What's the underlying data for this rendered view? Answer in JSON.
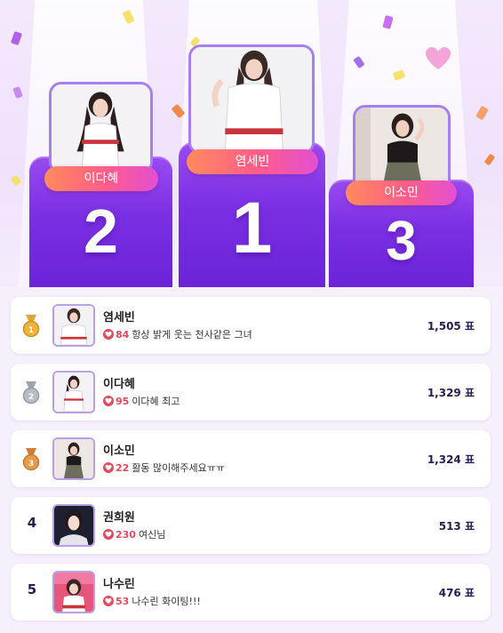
{
  "podium": [
    {
      "rank_label": "2",
      "name": "이다혜"
    },
    {
      "rank_label": "1",
      "name": "염세빈"
    },
    {
      "rank_label": "3",
      "name": "이소민"
    }
  ],
  "leaderboard": [
    {
      "rank": 1,
      "rank_label": "",
      "medal": "gold-medal-icon",
      "name": "염세빈",
      "hearts": "84",
      "message": "항상 밝게 웃는 천사같은 그녀",
      "votes": "1,505 표"
    },
    {
      "rank": 2,
      "rank_label": "",
      "medal": "silver-medal-icon",
      "name": "이다혜",
      "hearts": "95",
      "message": "이다혜 최고",
      "votes": "1,329 표"
    },
    {
      "rank": 3,
      "rank_label": "",
      "medal": "bronze-medal-icon",
      "name": "이소민",
      "hearts": "22",
      "message": "활동 많이해주세요ㅠㅠ",
      "votes": "1,324 표"
    },
    {
      "rank": 4,
      "rank_label": "4",
      "medal": "",
      "name": "권희원",
      "hearts": "230",
      "message": "여신님",
      "votes": "513 표"
    },
    {
      "rank": 5,
      "rank_label": "5",
      "medal": "",
      "name": "나수린",
      "hearts": "53",
      "message": "나수린 화이팅!!!",
      "votes": "476 표"
    }
  ],
  "colors": {
    "podium_purple": "#7a2fe3",
    "pill_gradient_start": "#ff8a5c",
    "pill_gradient_end": "#e24fd3",
    "heart": "#e24a5e",
    "gold": "#f0b43a",
    "silver": "#b8bcc4",
    "bronze": "#e89a4c"
  }
}
